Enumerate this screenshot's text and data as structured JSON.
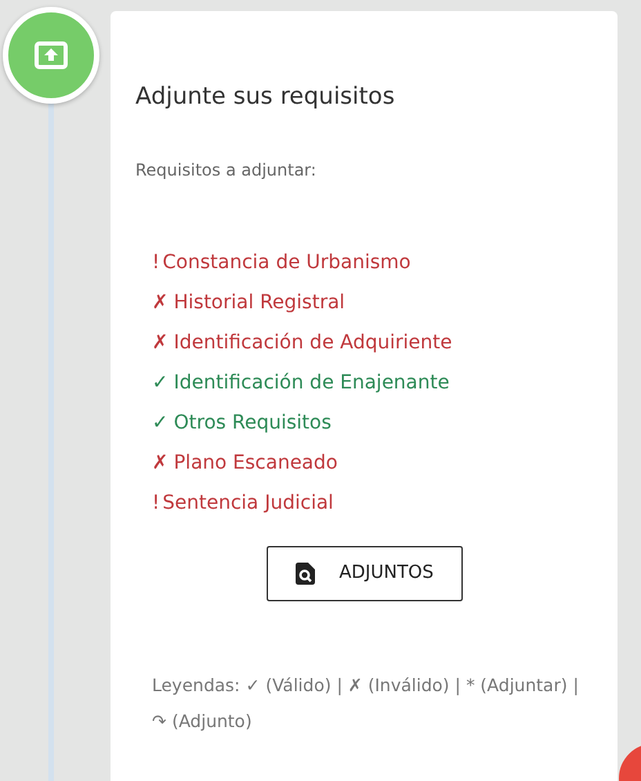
{
  "card": {
    "title": "Adjunte sus requisitos",
    "subtitle": "Requisitos a adjuntar:"
  },
  "requirements": [
    {
      "kind": "pending",
      "mark": "!",
      "label": "Constancia de Urbanismo"
    },
    {
      "kind": "invalid",
      "mark": "✗",
      "label": "Historial Registral"
    },
    {
      "kind": "invalid",
      "mark": "✗",
      "label": "Identificación de Adquiriente"
    },
    {
      "kind": "valid",
      "mark": "✓",
      "label": "Identificación de Enajenante"
    },
    {
      "kind": "valid",
      "mark": "✓",
      "label": "Otros Requisitos"
    },
    {
      "kind": "invalid",
      "mark": "✗",
      "label": "Plano Escaneado"
    },
    {
      "kind": "pending",
      "mark": "!",
      "label": "Sentencia Judicial"
    }
  ],
  "button": {
    "label": "ADJUNTOS"
  },
  "legend": "Leyendas: **✓** (Válido) | **✗** (Inválido) | * (Adjuntar) | ↷ (Adjunto)"
}
